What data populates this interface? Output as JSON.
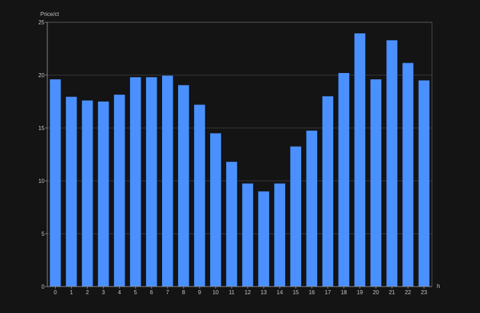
{
  "colors": {
    "background": "#141414",
    "bar": "#4a90ff",
    "grid": "#5a5a5a",
    "axis": "#8a8a8a",
    "text": "#c8c8c8"
  },
  "chart_data": {
    "type": "bar",
    "title": "",
    "ylabel": "Price/ct",
    "xlabel": "h",
    "categories": [
      "0",
      "1",
      "2",
      "3",
      "4",
      "5",
      "6",
      "7",
      "8",
      "9",
      "10",
      "11",
      "12",
      "13",
      "14",
      "15",
      "16",
      "17",
      "18",
      "19",
      "20",
      "21",
      "22",
      "23"
    ],
    "values": [
      19.6,
      17.95,
      17.6,
      17.5,
      18.15,
      19.8,
      19.8,
      19.95,
      19.05,
      17.2,
      14.5,
      11.8,
      9.75,
      9.0,
      9.75,
      13.25,
      14.75,
      18.0,
      20.2,
      23.95,
      19.6,
      23.3,
      21.15,
      19.5
    ],
    "ylim": [
      0,
      25
    ],
    "yticks": [
      0,
      5,
      10,
      15,
      20,
      25
    ],
    "grid": true,
    "legend": "none"
  }
}
